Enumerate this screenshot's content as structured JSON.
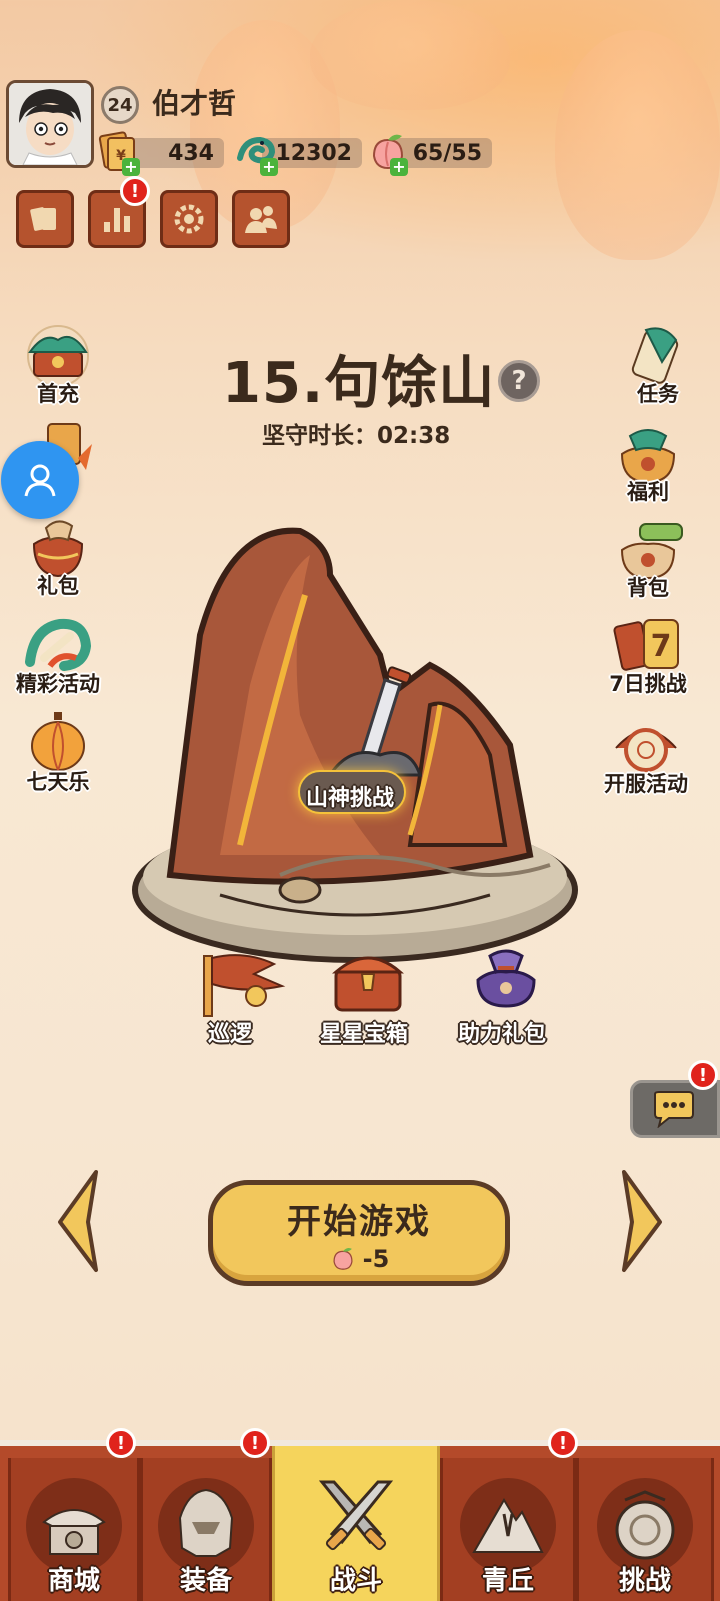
{
  "player": {
    "level": "24",
    "name": "伯才哲"
  },
  "resources": {
    "coupons": "434",
    "jade": "12302",
    "stamina": "65/55"
  },
  "top_buttons": [
    "card-icon",
    "stats-icon",
    "settings-icon",
    "friends-icon"
  ],
  "left_menu": [
    {
      "label": "首充",
      "icon": "first-recharge-icon"
    },
    {
      "label": "",
      "icon": "upgrade-icon"
    },
    {
      "label": "礼包",
      "icon": "gift-bag-icon"
    },
    {
      "label": "精彩活动",
      "icon": "dragon-event-icon"
    },
    {
      "label": "七天乐",
      "icon": "lantern-icon"
    }
  ],
  "right_menu": [
    {
      "label": "任务",
      "icon": "scroll-icon"
    },
    {
      "label": "福利",
      "icon": "welfare-bag-icon"
    },
    {
      "label": "背包",
      "icon": "backpack-icon"
    },
    {
      "label": "7日挑战",
      "icon": "seven-day-icon"
    },
    {
      "label": "开服活动",
      "icon": "server-event-icon"
    }
  ],
  "stage": {
    "title": "15.句馀山",
    "help": "?",
    "guard_time": "坚守时长：02:38"
  },
  "map_actions": {
    "mountain_challenge": "山神挑战",
    "patrol": "巡逻",
    "star_chest": "星星宝箱",
    "assist_gift": "助力礼包"
  },
  "start": {
    "label": "开始游戏",
    "cost": "-5"
  },
  "notification": "!",
  "nav": [
    {
      "label": "商城",
      "badge": "!"
    },
    {
      "label": "装备",
      "badge": "!"
    },
    {
      "label": "战斗",
      "badge": ""
    },
    {
      "label": "青丘",
      "badge": "!"
    },
    {
      "label": "挑战",
      "badge": ""
    }
  ],
  "colors": {
    "accent": "#f2c75c",
    "nav_bg": "#b44a2a",
    "badge": "#e0231c",
    "float_button": "#2f95f1"
  }
}
